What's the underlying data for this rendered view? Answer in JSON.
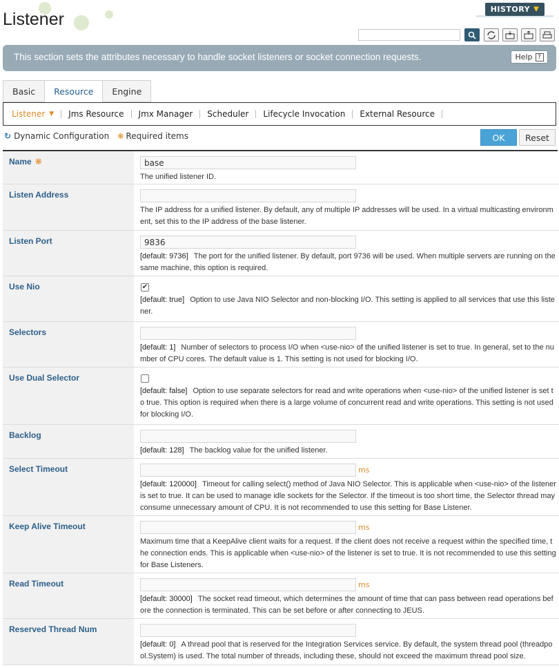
{
  "header": {
    "title": "Listener",
    "history_label": "HISTORY",
    "search_value": ""
  },
  "toolbar_icons": [
    "search-icon",
    "refresh-icon",
    "export-xml-icon",
    "import-xml-icon",
    "print-icon"
  ],
  "banner": {
    "text": "This section sets the attributes necessary to handle socket listeners or socket connection requests.",
    "help_label": "Help",
    "help_icon": "?"
  },
  "tabs": [
    {
      "label": "Basic",
      "active": false
    },
    {
      "label": "Resource",
      "active": true
    },
    {
      "label": "Engine",
      "active": false
    }
  ],
  "subnav": [
    {
      "label": "Listener",
      "active": true
    },
    {
      "label": "Jms Resource",
      "active": false
    },
    {
      "label": "Jmx Manager",
      "active": false
    },
    {
      "label": "Scheduler",
      "active": false
    },
    {
      "label": "Lifecycle Invocation",
      "active": false
    },
    {
      "label": "External Resource",
      "active": false
    }
  ],
  "legend": {
    "dynamic": "Dynamic Configuration",
    "required": "Required items"
  },
  "actions": {
    "ok": "OK",
    "reset": "Reset"
  },
  "colors": {
    "accent": "#4aa3d6",
    "label": "#2d5f8a",
    "orange": "#e08a25",
    "banner": "#98aab6"
  },
  "fields": [
    {
      "label": "Name",
      "required": true,
      "value": "base",
      "default": "",
      "desc": "The unified listener ID."
    },
    {
      "label": "Listen Address",
      "value": "",
      "default": "",
      "desc": "The IP address for a unified listener. By default, any of multiple IP addresses will be used. In a virtual multicasting environment, set this to the IP address of the base listener."
    },
    {
      "label": "Listen Port",
      "value": "9836",
      "default": "[default: 9736]",
      "desc": "The port for the unified listener. By default, port 9736 will be used. When multiple servers are running on the same machine, this option is required."
    },
    {
      "label": "Use Nio",
      "checked": true,
      "default": "[default: true]",
      "desc": "Option to use Java NIO Selector and non-blocking I/O. This setting is applied to all services that use this listener."
    },
    {
      "label": "Selectors",
      "value": "",
      "default": "[default: 1]",
      "desc": "Number of selectors to process I/O when <use-nio> of the unified listener is set to true. In general, set to the number of CPU cores. The default value is 1. This setting is not used for blocking I/O."
    },
    {
      "label": "Use Dual Selector",
      "checked": false,
      "default": "[default: false]",
      "desc": "Option to use separate selectors for read and write operations when <use-nio> of the unified listener is set to true. This option is required when there is a large volume of concurrent read and write operations. This setting is not used for blocking I/O."
    },
    {
      "label": "Backlog",
      "value": "",
      "default": "[default: 128]",
      "desc": "The backlog value for the unified listener."
    },
    {
      "label": "Select Timeout",
      "value": "",
      "unit": "ms",
      "default": "[default: 120000]",
      "desc": "Timeout for calling select() method of Java NIO Selector. This is applicable when <use-nio> of the listener is set to true. It can be used to manage idle sockets for the Selector. If the timeout is too short time, the Selector thread may consume unnecessary amount of CPU. It is not recommended to use this setting for Base Listener."
    },
    {
      "label": "Keep Alive Timeout",
      "value": "",
      "unit": "ms",
      "default": "",
      "desc": "Maximum time that a KeepAlive client waits for a request. If the client does not receive a request within the specified time, the connection ends. This is applicable when <use-nio> of the listener is set to true. It is not recommended to use this setting for Base Listeners."
    },
    {
      "label": "Read Timeout",
      "value": "",
      "unit": "ms",
      "default": "[default: 30000]",
      "desc": "The socket read timeout, which determines the amount of time that can pass between read operations before the connection is terminated. This can be set before or after connecting to JEUS."
    },
    {
      "label": "Reserved Thread Num",
      "value": "",
      "default": "[default: 0]",
      "desc": "A thread pool that is reserved for the Integration Services service. By default, the system thread pool (threadpool.System) is used. The total number of threads, including these, should not exceed the maximum thread pool size."
    }
  ]
}
